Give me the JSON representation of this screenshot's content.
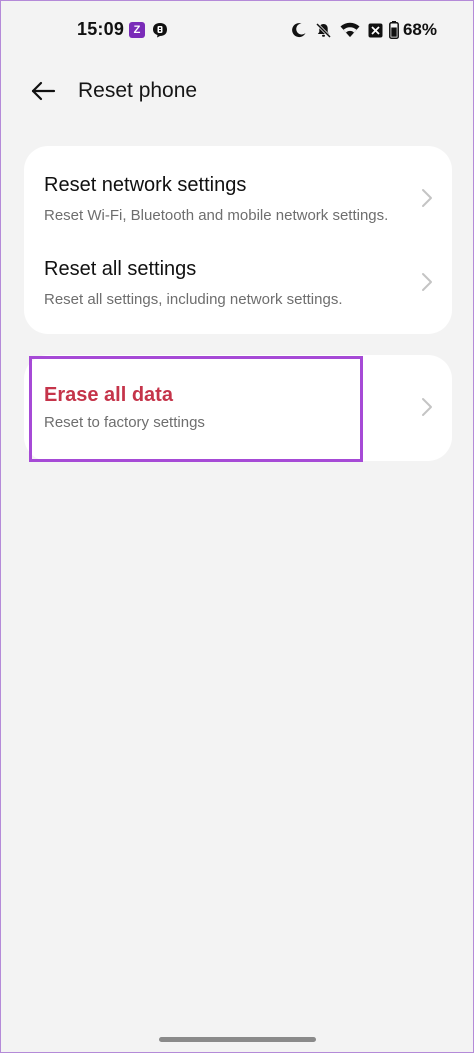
{
  "status_bar": {
    "time": "15:09",
    "notification_app_letter": "Z",
    "battery_percent": "68%",
    "icons": [
      "z-app-icon",
      "notification-b-icon",
      "do-not-disturb-moon-icon",
      "silent-bell-icon",
      "wifi-icon",
      "sim-off-icon",
      "battery-icon"
    ]
  },
  "header": {
    "title": "Reset phone",
    "back_icon": "arrow-left-icon"
  },
  "settings": {
    "items": [
      {
        "title": "Reset network settings",
        "subtitle": "Reset Wi-Fi, Bluetooth and mobile network settings."
      },
      {
        "title": "Reset all settings",
        "subtitle": "Reset all settings, including network settings."
      }
    ],
    "erase": {
      "title": "Erase all data",
      "subtitle": "Reset to factory settings"
    }
  },
  "colors": {
    "background": "#f3f3f3",
    "card": "#ffffff",
    "erase_title": "#c5344a",
    "highlight_border": "#a64ad6"
  }
}
